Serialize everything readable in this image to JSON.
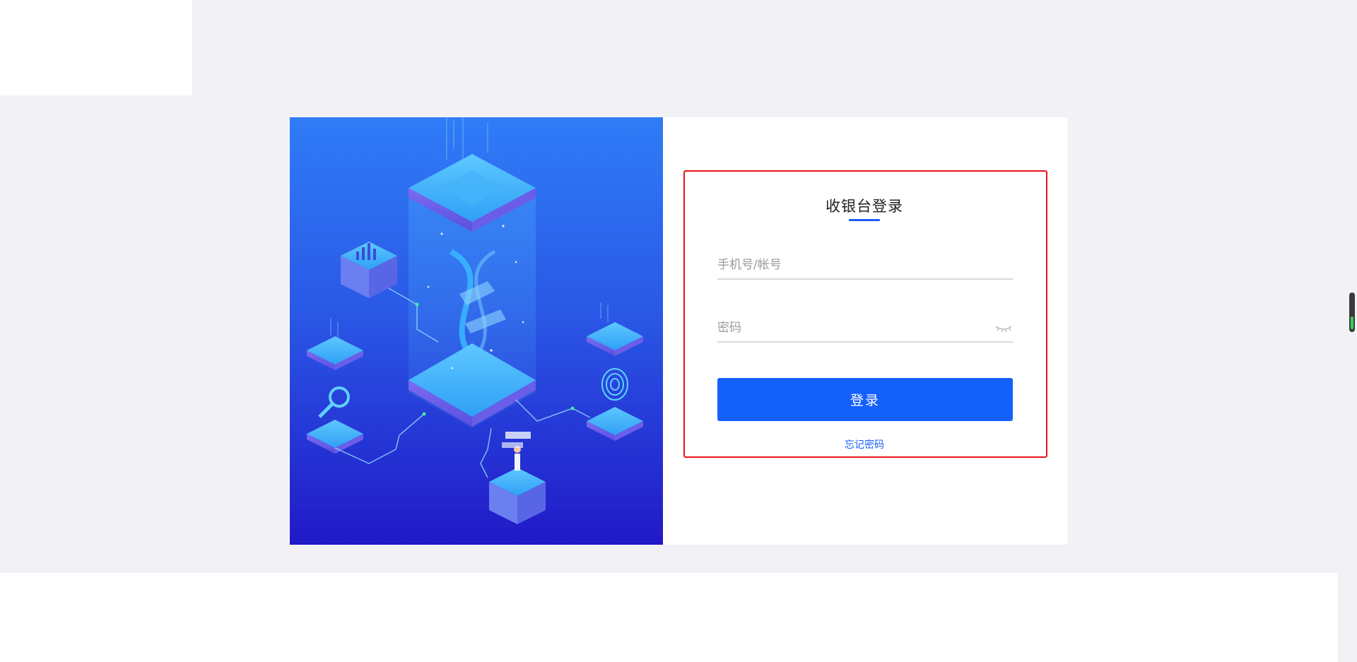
{
  "login": {
    "title": "收银台登录",
    "account_placeholder": "手机号/帐号",
    "password_placeholder": "密码",
    "login_button": "登录",
    "forgot_password": "忘记密码"
  },
  "colors": {
    "accent": "#1460fb",
    "highlight_frame": "#e8141a",
    "illustration_top": "#2f7cf7",
    "illustration_bottom": "#2119c7"
  },
  "icons": {
    "password_toggle": "eye-closed-icon"
  }
}
